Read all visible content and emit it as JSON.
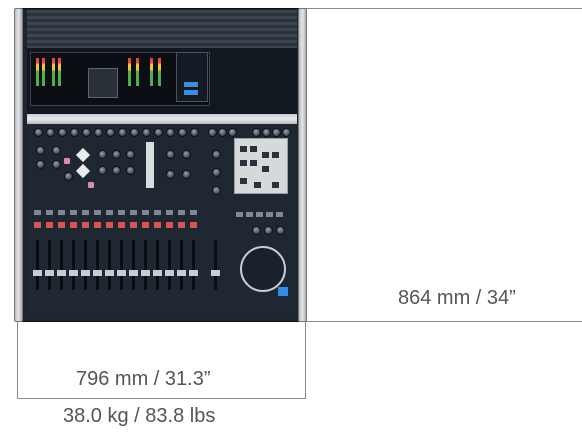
{
  "dimensions": {
    "width": "796 mm / 31.3”",
    "height": "864 mm / 34”",
    "weight": "38.0 kg / 83.8 lbs"
  },
  "colors": {
    "console_body": "#1e2530",
    "dimension_line": "#8a8a8a",
    "dimension_text": "#555555",
    "accent_blue": "#2f8fe8",
    "button_red": "#d9534f"
  }
}
